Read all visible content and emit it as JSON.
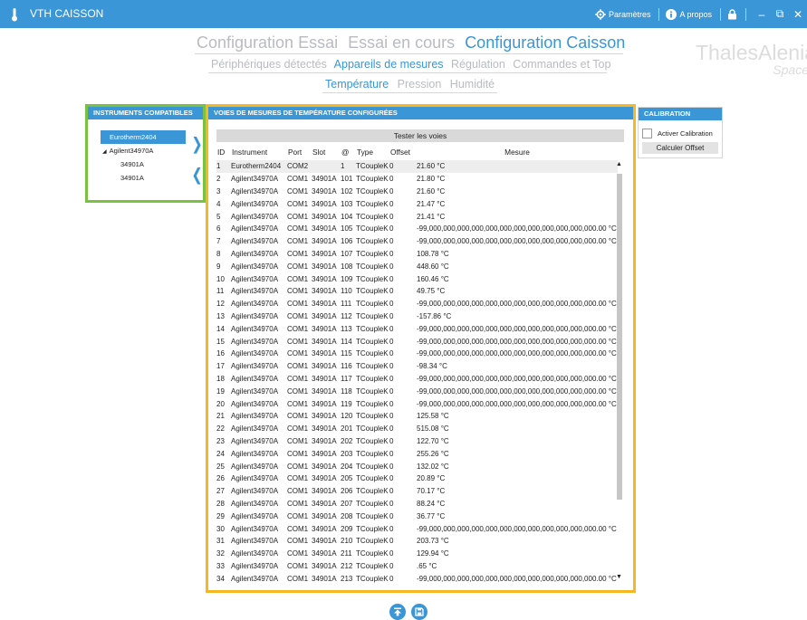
{
  "titlebar": {
    "title": "VTH CAISSON",
    "settings_label": "Paramètres",
    "about_label": "A propos"
  },
  "nav": {
    "main_tabs": [
      {
        "label": "Configuration Essai"
      },
      {
        "label": "Essai en cours"
      },
      {
        "label": "Configuration Caisson"
      }
    ],
    "sub_tabs": [
      {
        "label": "Périphériques détectés"
      },
      {
        "label": "Appareils de mesures"
      },
      {
        "label": "Régulation"
      },
      {
        "label": "Commandes et Top"
      }
    ],
    "measure_tabs": [
      {
        "label": "Température"
      },
      {
        "label": "Pression"
      },
      {
        "label": "Humidité"
      }
    ]
  },
  "logo": {
    "line1": "ThalesAlenia",
    "line2": "Space"
  },
  "instruments": {
    "title": "INSTRUMENTS COMPATIBLES",
    "items": [
      {
        "label": "Eurotherm2404"
      },
      {
        "label": "Agilent34970A"
      },
      {
        "label": "34901A"
      },
      {
        "label": "34901A"
      }
    ]
  },
  "voies": {
    "title": "VOIES DE MESURES DE TEMPÉRATURE CONFIGURÉES",
    "test_button": "Tester les voies",
    "columns": [
      "ID",
      "Instrument",
      "Port",
      "Slot",
      "@",
      "Type",
      "Offset",
      "Mesure"
    ],
    "rows": [
      [
        "1",
        "Eurotherm2404",
        "COM2",
        "",
        "1",
        "TCoupleK",
        "0",
        "21.60 °C"
      ],
      [
        "2",
        "Agilent34970A",
        "COM1",
        "34901A",
        "101",
        "TCoupleK",
        "0",
        "21.80 °C"
      ],
      [
        "3",
        "Agilent34970A",
        "COM1",
        "34901A",
        "102",
        "TCoupleK",
        "0",
        "21.60 °C"
      ],
      [
        "4",
        "Agilent34970A",
        "COM1",
        "34901A",
        "103",
        "TCoupleK",
        "0",
        "21.47 °C"
      ],
      [
        "5",
        "Agilent34970A",
        "COM1",
        "34901A",
        "104",
        "TCoupleK",
        "0",
        "21.41 °C"
      ],
      [
        "6",
        "Agilent34970A",
        "COM1",
        "34901A",
        "105",
        "TCoupleK",
        "0",
        "-99,000,000,000,000,000,000,000,000,000,000,000,000.00 °C"
      ],
      [
        "7",
        "Agilent34970A",
        "COM1",
        "34901A",
        "106",
        "TCoupleK",
        "0",
        "-99,000,000,000,000,000,000,000,000,000,000,000,000.00 °C"
      ],
      [
        "8",
        "Agilent34970A",
        "COM1",
        "34901A",
        "107",
        "TCoupleK",
        "0",
        "108.78 °C"
      ],
      [
        "9",
        "Agilent34970A",
        "COM1",
        "34901A",
        "108",
        "TCoupleK",
        "0",
        "448.60 °C"
      ],
      [
        "10",
        "Agilent34970A",
        "COM1",
        "34901A",
        "109",
        "TCoupleK",
        "0",
        "160.46 °C"
      ],
      [
        "11",
        "Agilent34970A",
        "COM1",
        "34901A",
        "110",
        "TCoupleK",
        "0",
        "49.75 °C"
      ],
      [
        "12",
        "Agilent34970A",
        "COM1",
        "34901A",
        "111",
        "TCoupleK",
        "0",
        "-99,000,000,000,000,000,000,000,000,000,000,000,000.00 °C"
      ],
      [
        "13",
        "Agilent34970A",
        "COM1",
        "34901A",
        "112",
        "TCoupleK",
        "0",
        "-157.86 °C"
      ],
      [
        "14",
        "Agilent34970A",
        "COM1",
        "34901A",
        "113",
        "TCoupleK",
        "0",
        "-99,000,000,000,000,000,000,000,000,000,000,000,000.00 °C"
      ],
      [
        "15",
        "Agilent34970A",
        "COM1",
        "34901A",
        "114",
        "TCoupleK",
        "0",
        "-99,000,000,000,000,000,000,000,000,000,000,000,000.00 °C"
      ],
      [
        "16",
        "Agilent34970A",
        "COM1",
        "34901A",
        "115",
        "TCoupleK",
        "0",
        "-99,000,000,000,000,000,000,000,000,000,000,000,000.00 °C"
      ],
      [
        "17",
        "Agilent34970A",
        "COM1",
        "34901A",
        "116",
        "TCoupleK",
        "0",
        "-98.34 °C"
      ],
      [
        "18",
        "Agilent34970A",
        "COM1",
        "34901A",
        "117",
        "TCoupleK",
        "0",
        "-99,000,000,000,000,000,000,000,000,000,000,000,000.00 °C"
      ],
      [
        "19",
        "Agilent34970A",
        "COM1",
        "34901A",
        "118",
        "TCoupleK",
        "0",
        "-99,000,000,000,000,000,000,000,000,000,000,000,000.00 °C"
      ],
      [
        "20",
        "Agilent34970A",
        "COM1",
        "34901A",
        "119",
        "TCoupleK",
        "0",
        "-99,000,000,000,000,000,000,000,000,000,000,000,000.00 °C"
      ],
      [
        "21",
        "Agilent34970A",
        "COM1",
        "34901A",
        "120",
        "TCoupleK",
        "0",
        "125.58 °C"
      ],
      [
        "22",
        "Agilent34970A",
        "COM1",
        "34901A",
        "201",
        "TCoupleK",
        "0",
        "515.08 °C"
      ],
      [
        "23",
        "Agilent34970A",
        "COM1",
        "34901A",
        "202",
        "TCoupleK",
        "0",
        "122.70 °C"
      ],
      [
        "24",
        "Agilent34970A",
        "COM1",
        "34901A",
        "203",
        "TCoupleK",
        "0",
        "255.26 °C"
      ],
      [
        "25",
        "Agilent34970A",
        "COM1",
        "34901A",
        "204",
        "TCoupleK",
        "0",
        "132.02 °C"
      ],
      [
        "26",
        "Agilent34970A",
        "COM1",
        "34901A",
        "205",
        "TCoupleK",
        "0",
        "20.89 °C"
      ],
      [
        "27",
        "Agilent34970A",
        "COM1",
        "34901A",
        "206",
        "TCoupleK",
        "0",
        "70.17 °C"
      ],
      [
        "28",
        "Agilent34970A",
        "COM1",
        "34901A",
        "207",
        "TCoupleK",
        "0",
        "88.24 °C"
      ],
      [
        "29",
        "Agilent34970A",
        "COM1",
        "34901A",
        "208",
        "TCoupleK",
        "0",
        "36.77 °C"
      ],
      [
        "30",
        "Agilent34970A",
        "COM1",
        "34901A",
        "209",
        "TCoupleK",
        "0",
        "-99,000,000,000,000,000,000,000,000,000,000,000,000.00 °C"
      ],
      [
        "31",
        "Agilent34970A",
        "COM1",
        "34901A",
        "210",
        "TCoupleK",
        "0",
        "203.73 °C"
      ],
      [
        "32",
        "Agilent34970A",
        "COM1",
        "34901A",
        "211",
        "TCoupleK",
        "0",
        "129.94 °C"
      ],
      [
        "33",
        "Agilent34970A",
        "COM1",
        "34901A",
        "212",
        "TCoupleK",
        "0",
        ".65 °C"
      ],
      [
        "34",
        "Agilent34970A",
        "COM1",
        "34901A",
        "213",
        "TCoupleK",
        "0",
        "-99,000,000,000,000,000,000,000,000,000,000,000,000.00 °C"
      ]
    ]
  },
  "calibration": {
    "title": "CALIBRATION",
    "checkbox_label": "Activer Calibration",
    "checkbox_checked": false,
    "button_label": "Calculer Offset"
  },
  "icons": {
    "upload": "upload-icon",
    "save": "save-icon",
    "gear": "gear-icon",
    "info": "info-icon",
    "lock": "lock-icon"
  },
  "colors": {
    "accent": "#3a96d6",
    "instrument_border": "#7ac143",
    "voies_border": "#f5b820"
  }
}
